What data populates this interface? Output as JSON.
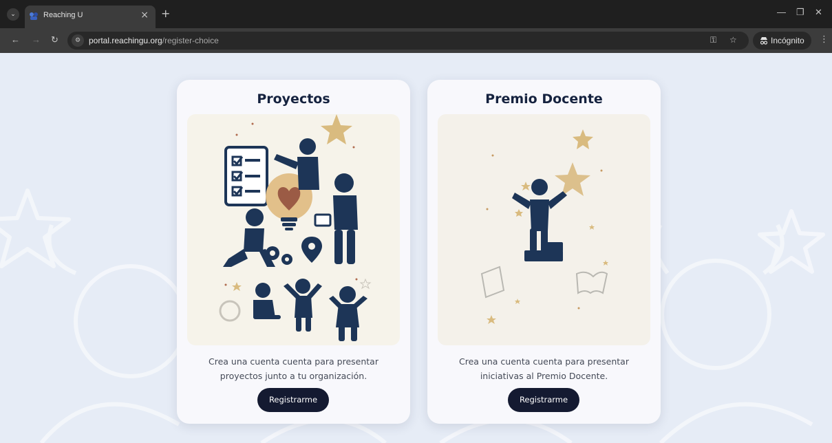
{
  "browser": {
    "tab_title": "Reaching U",
    "url_host": "portal.reachingu.org",
    "url_path": "/register-choice",
    "incognito_label": "Incógnito"
  },
  "cards": [
    {
      "title": "Proyectos",
      "desc_line1": "Crea una cuenta cuenta para presentar",
      "desc_line2": "proyectos junto a tu organización.",
      "button": "Registrarme"
    },
    {
      "title": "Premio Docente",
      "desc_line1": "Crea una cuenta cuenta para presentar",
      "desc_line2": "iniciativas al Premio Docente.",
      "button": "Registrarme"
    }
  ],
  "colors": {
    "navy": "#1d3557",
    "gold": "#d9bb7f",
    "button_bg": "#141a31"
  }
}
